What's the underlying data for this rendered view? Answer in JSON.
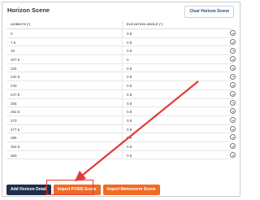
{
  "panel": {
    "title": "Horizon Scene",
    "clear_button": "Clear Horizon Scene"
  },
  "table": {
    "headers": {
      "azimuth": "AZIMUTH (°)",
      "elevation": "ELEVATION ANGLE (°)"
    },
    "rows": [
      {
        "azimuth": "0",
        "elevation": "0.8"
      },
      {
        "azimuth": "7.5",
        "elevation": "0.8"
      },
      {
        "azimuth": "15",
        "elevation": "0.8"
      },
      {
        "azimuth": "207.5",
        "elevation": "0"
      },
      {
        "azimuth": "225",
        "elevation": "0.8"
      },
      {
        "azimuth": "232.5",
        "elevation": "0.8"
      },
      {
        "azimuth": "240",
        "elevation": "0.8"
      },
      {
        "azimuth": "247.5",
        "elevation": "0.8"
      },
      {
        "azimuth": "255",
        "elevation": "0.8"
      },
      {
        "azimuth": "262.5",
        "elevation": "0.8"
      },
      {
        "azimuth": "270",
        "elevation": "0.8"
      },
      {
        "azimuth": "277.5",
        "elevation": "0.8"
      },
      {
        "azimuth": "285",
        "elevation": "0.8"
      },
      {
        "azimuth": "352.5",
        "elevation": "0.8"
      },
      {
        "azimuth": "360",
        "elevation": "0.8"
      }
    ]
  },
  "footer": {
    "add_detail": "Add Horizon Detail",
    "import_pvsyst": "Import PVSIS Scene",
    "import_meteonorm": "Import Meteonorm Scene"
  },
  "colors": {
    "navy": "#1f2f4a",
    "orange": "#ef6a23",
    "annotation_red": "#e53935"
  }
}
